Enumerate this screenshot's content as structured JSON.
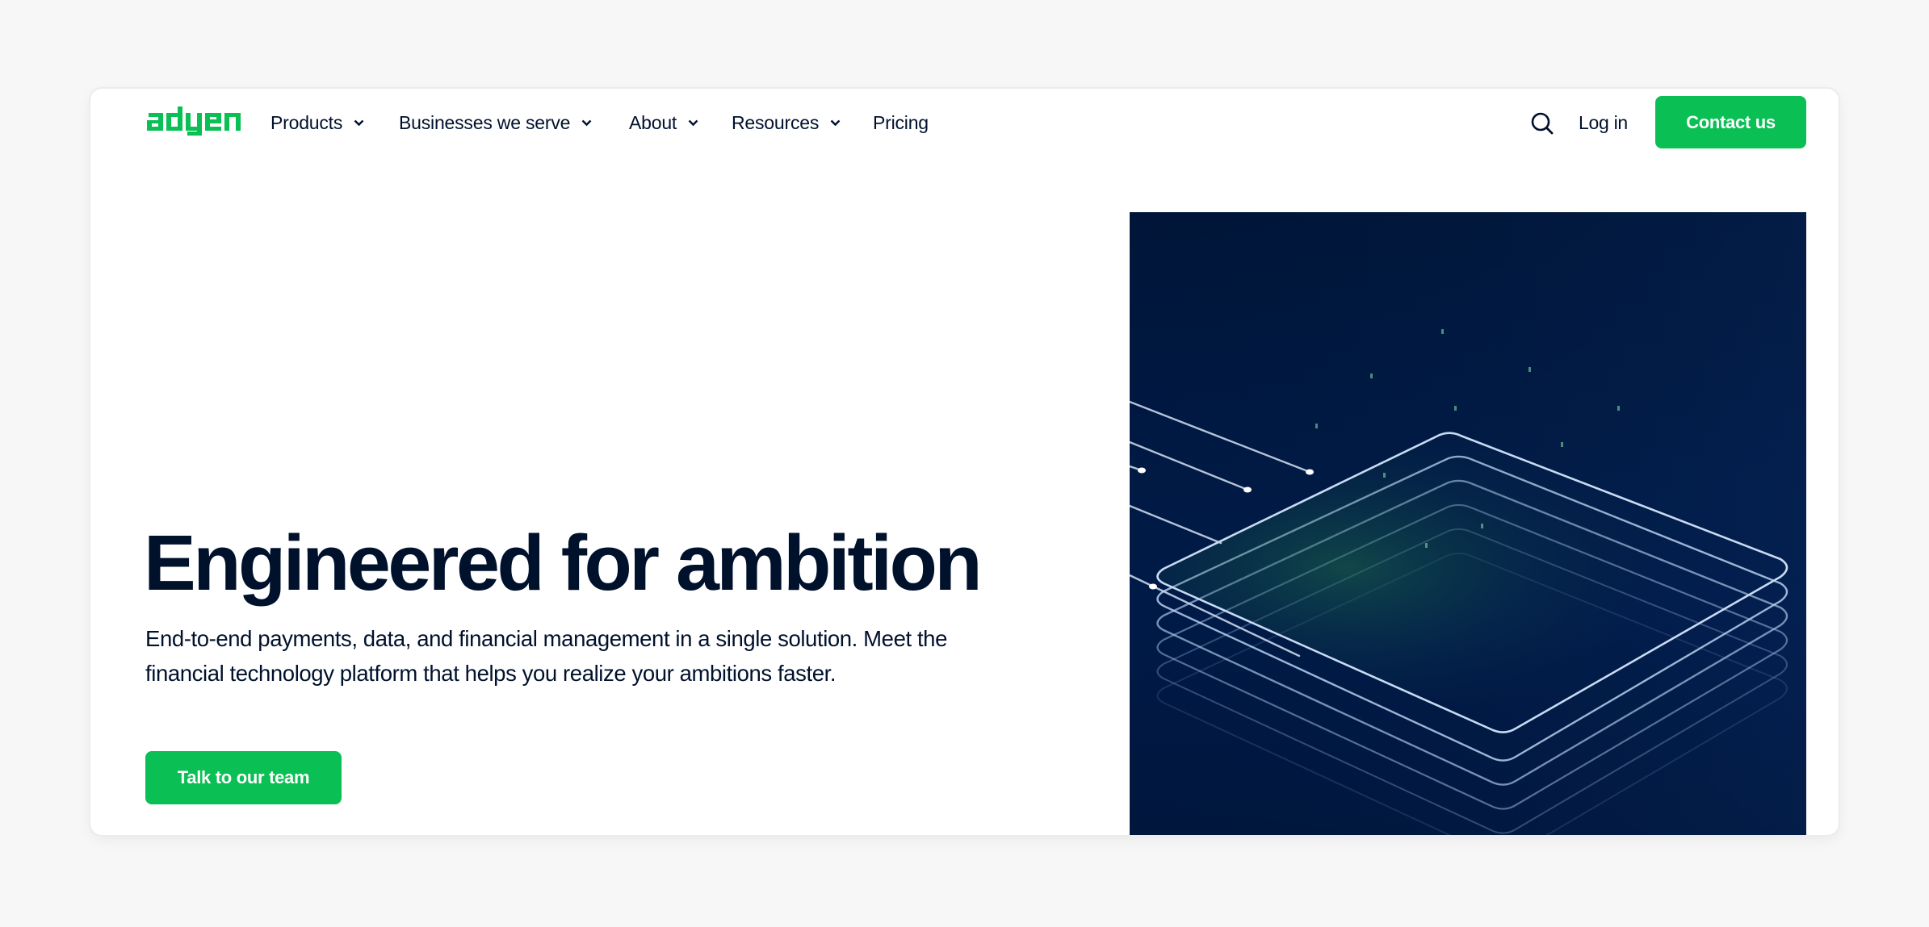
{
  "header": {
    "logo_text": "adyen",
    "nav": [
      {
        "label": "Products",
        "has_dropdown": true
      },
      {
        "label": "Businesses we serve",
        "has_dropdown": true
      },
      {
        "label": "About",
        "has_dropdown": true
      },
      {
        "label": "Resources",
        "has_dropdown": true
      },
      {
        "label": "Pricing",
        "has_dropdown": false
      }
    ],
    "search_icon": "search-icon",
    "login_label": "Log in",
    "contact_label": "Contact us"
  },
  "hero": {
    "title": "Engineered for ambition",
    "subtitle": "End-to-end payments, data, and financial management in a single solution. Meet the financial technology platform that helps you realize your ambitions faster.",
    "cta_label": "Talk to our team",
    "visual": "layered-platform-illustration"
  },
  "colors": {
    "brand_green": "#0abf53",
    "text_navy": "#00112c",
    "visual_background": "#001a45",
    "page_background": "#f7f7f7"
  }
}
